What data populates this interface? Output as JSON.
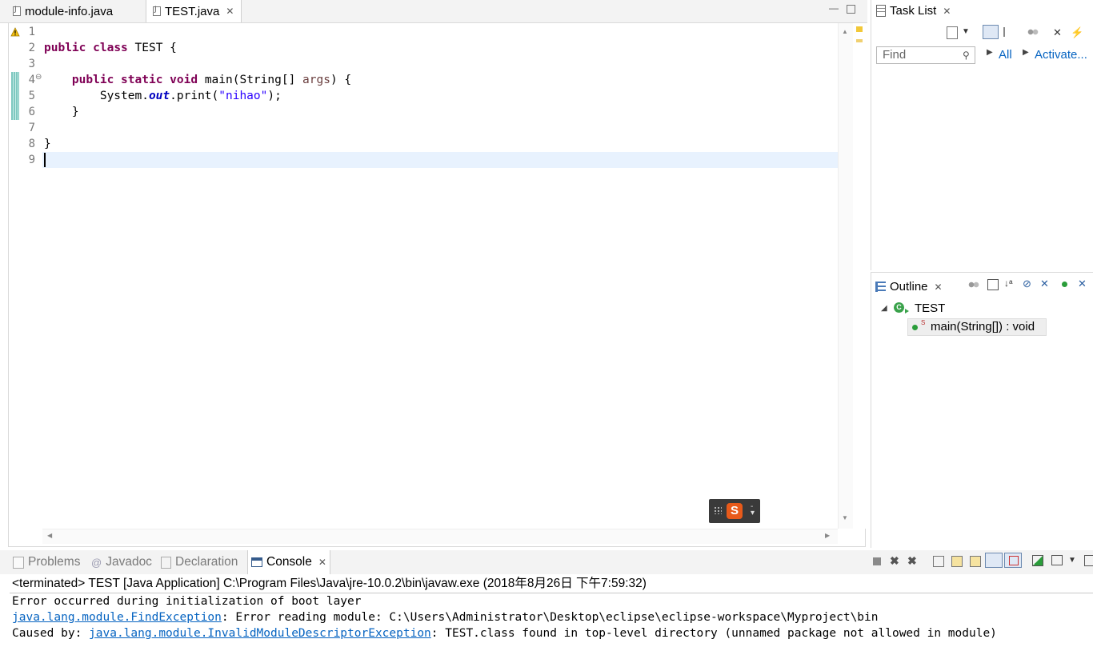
{
  "editor": {
    "tabs": [
      {
        "label": "module-info.java",
        "active": false
      },
      {
        "label": "TEST.java",
        "active": true
      }
    ],
    "line_numbers": [
      "1",
      "2",
      "3",
      "4",
      "5",
      "6",
      "7",
      "8",
      "9"
    ],
    "code": {
      "l2": {
        "kw1": "public",
        "kw2": "class",
        "rest": " TEST {"
      },
      "l4": {
        "indent": "    ",
        "kw1": "public",
        "kw2": "static",
        "kw3": "void",
        "mid": " main(String[] ",
        "param": "args",
        "end": ") {"
      },
      "l5": {
        "indent": "        ",
        "pre": "System.",
        "field": "out",
        "mid": ".print(",
        "str": "\"nihao\"",
        "end": ");"
      },
      "l6": {
        "text": "    }"
      },
      "l8": {
        "text": "}"
      }
    },
    "fold_marker": "⊖",
    "warning_icon": "warning-icon"
  },
  "tasklist": {
    "title": "Task List",
    "find_placeholder": "Find",
    "all_label": "All",
    "activate_label": "Activate..."
  },
  "outline": {
    "title": "Outline",
    "class_name": "TEST",
    "method_label": "main(String[]) : void",
    "static_marker": "S"
  },
  "console": {
    "tabs": [
      {
        "label": "Problems",
        "active": false
      },
      {
        "label": "Javadoc",
        "active": false
      },
      {
        "label": "Declaration",
        "active": false
      },
      {
        "label": "Console",
        "active": true
      }
    ],
    "terminated": "<terminated> TEST [Java Application] C:\\Program Files\\Java\\jre-10.0.2\\bin\\javaw.exe (2018年8月26日 下午7:59:32)",
    "line1": "Error occurred during initialization of boot layer",
    "line2_link": "java.lang.module.FindException",
    "line2_rest": ": Error reading module: C:\\Users\\Administrator\\Desktop\\eclipse\\eclipse-workspace\\Myproject\\bin",
    "line3_prefix": "Caused by: ",
    "line3_link": "java.lang.module.InvalidModuleDescriptorException",
    "line3_rest": ": TEST.class found in top-level directory (unnamed package not allowed in module)"
  },
  "colors": {
    "keyword": "#7f0055",
    "string": "#2a00ff",
    "field": "#0000c0",
    "link": "#0563c1",
    "current_line": "#e8f2fe"
  }
}
